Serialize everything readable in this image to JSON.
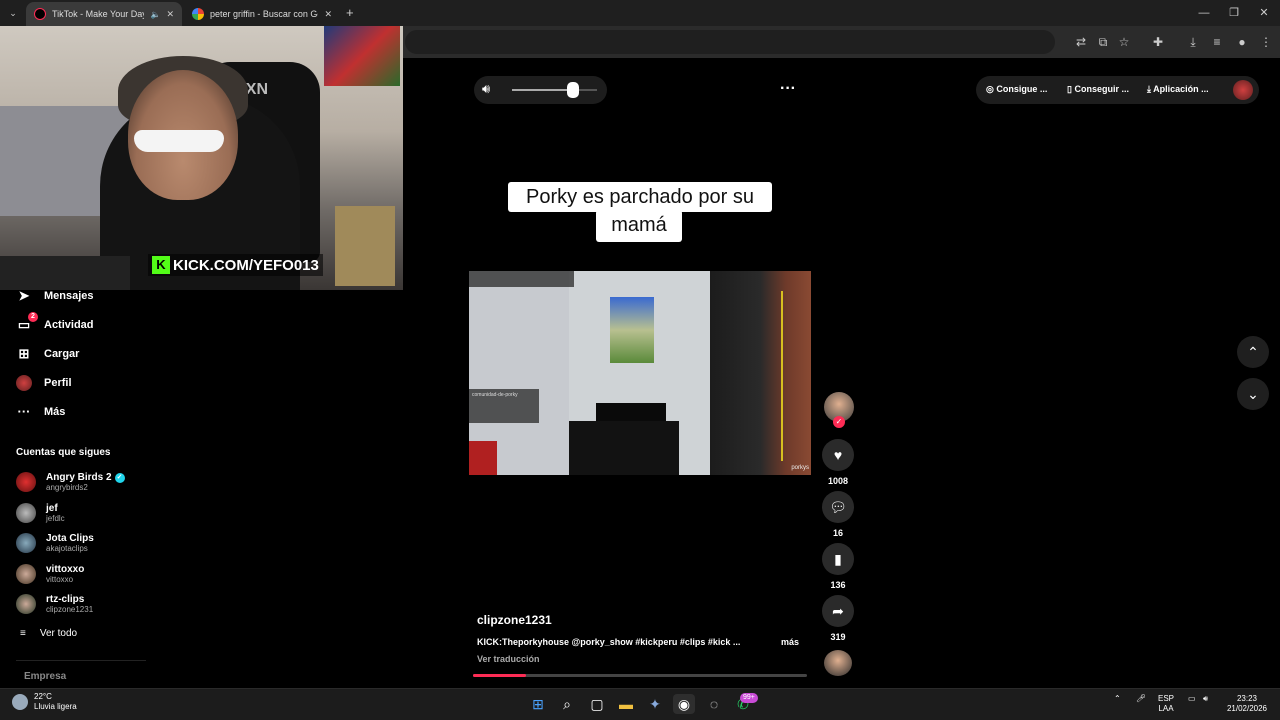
{
  "browser": {
    "tabs": [
      {
        "label": "TikTok - Make Your Day",
        "active": true
      },
      {
        "label": "peter griffin - Buscar con Google",
        "active": false
      }
    ],
    "new_tab": "+",
    "window_controls": {
      "minimize": "—",
      "restore": "❐",
      "close": "✕"
    }
  },
  "webcam": {
    "overlay_text": "KICK.COM/YEFO013",
    "chair_logo": "TXN"
  },
  "sidebar": {
    "nav": [
      {
        "label": "Mensajes",
        "icon": "send-icon"
      },
      {
        "label": "Actividad",
        "icon": "inbox-icon",
        "badge": "2"
      },
      {
        "label": "Cargar",
        "icon": "upload-icon"
      },
      {
        "label": "Perfil",
        "icon": "profile-avatar"
      },
      {
        "label": "Más",
        "icon": "more-icon"
      }
    ],
    "following_title": "Cuentas que sigues",
    "following": [
      {
        "name": "Angry Birds 2",
        "handle": "angrybirds2",
        "verified": true
      },
      {
        "name": "jef",
        "handle": "jefdlc"
      },
      {
        "name": "Jota Clips",
        "handle": "akajotaclips"
      },
      {
        "name": "vittoxxo",
        "handle": "vittoxxo"
      },
      {
        "name": "rtz-clips",
        "handle": "clipzone1231"
      }
    ],
    "see_all": "Ver todo",
    "company": "Empresa"
  },
  "player": {
    "volume_level": 0.72,
    "top_actions": [
      "Consigue ...",
      "Conseguir ...",
      "Aplicación ..."
    ],
    "caption_lines": [
      "Porky es parchado por su",
      "mamá"
    ],
    "video_tag": "porkys",
    "video_chat_label": "comunidad-de-porky",
    "progress": 0.16
  },
  "actions": {
    "likes": "1008",
    "comments": "16",
    "saves": "136",
    "shares": "319"
  },
  "post": {
    "username": "clipzone1231",
    "description": "KICK:Theporkyhouse @porky_show #kickperu #clips #kick ...",
    "more": "más",
    "translate": "Ver traducción"
  },
  "taskbar": {
    "weather_temp": "22°C",
    "weather_desc": "Lluvia ligera",
    "notify_badge": "99+",
    "lang_top": "ESP",
    "lang_bottom": "LAA",
    "time": "23:23",
    "date": "21/02/2026"
  },
  "colors": {
    "accent": "#fe2c55",
    "verified": "#20d5ec",
    "kick_green": "#53fc18"
  }
}
